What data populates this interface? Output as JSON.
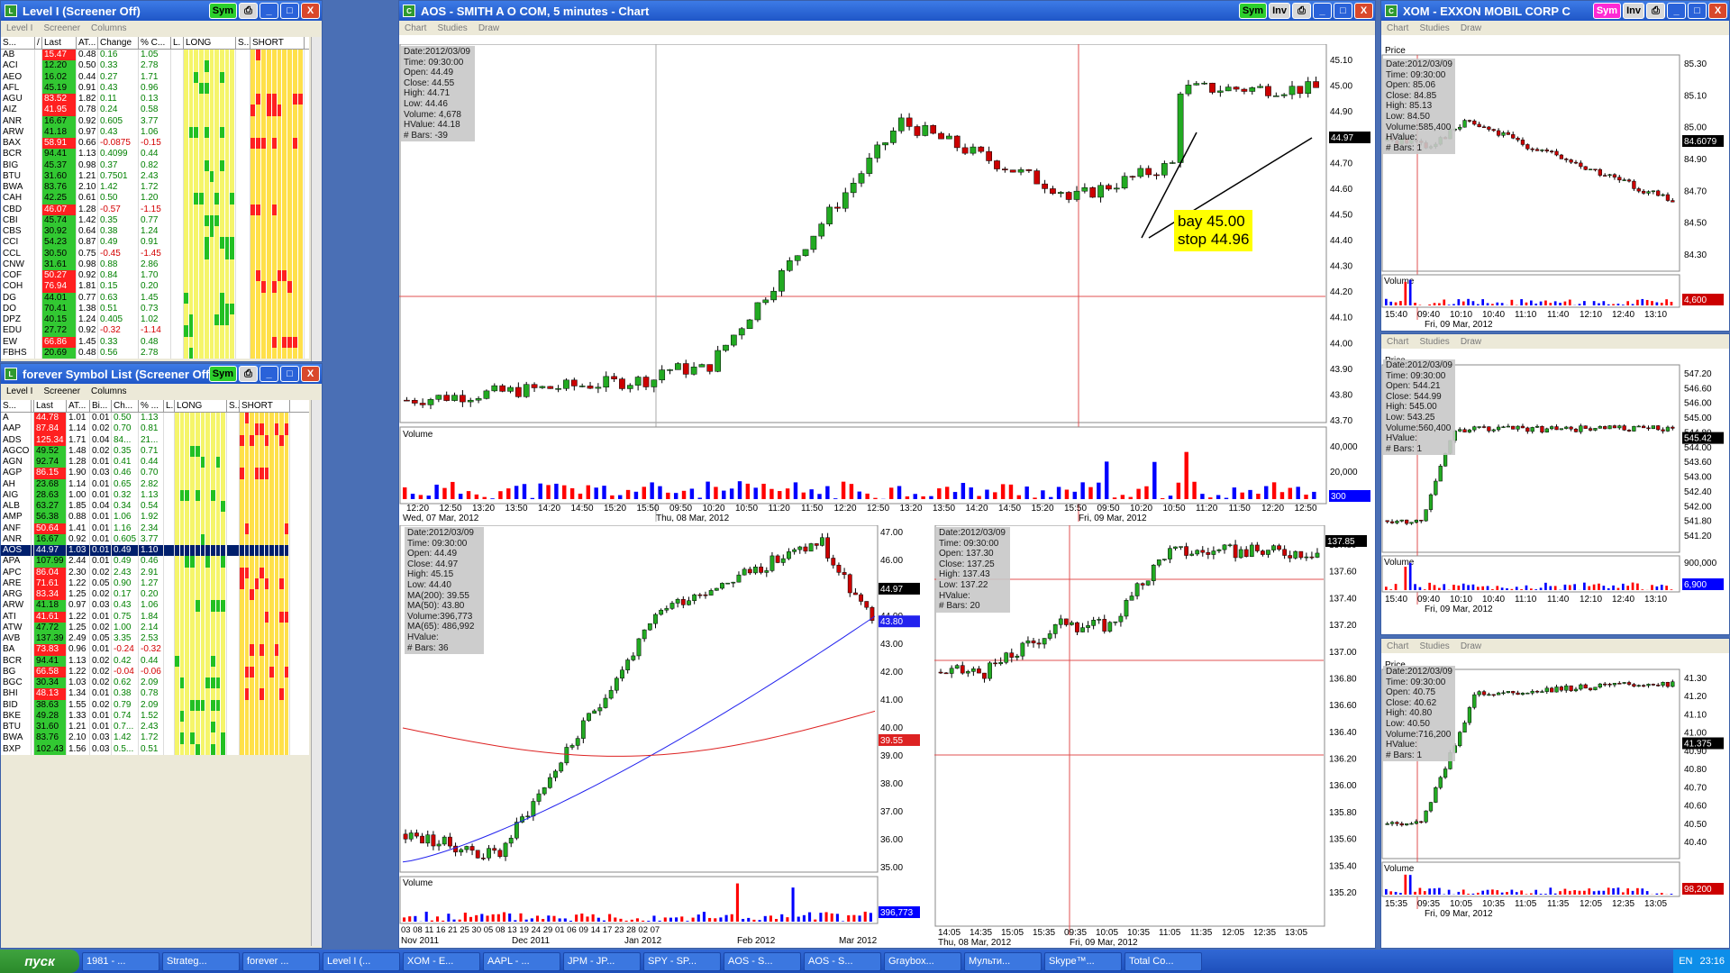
{
  "level1": {
    "title": "Level I (Screener Off)",
    "menu": [
      "Level I",
      "Screener",
      "Columns"
    ],
    "cols": [
      "S...",
      "/",
      "Last",
      "AT...",
      "Change",
      "% C...",
      "L.",
      "LONG",
      "S...",
      "SHORT"
    ],
    "rows": [
      [
        "AB",
        "15.47",
        "0.48",
        "0.16",
        "1.05",
        "r"
      ],
      [
        "ACI",
        "12.20",
        "0.50",
        "0.33",
        "2.78",
        "g"
      ],
      [
        "AEO",
        "16.02",
        "0.44",
        "0.27",
        "1.71",
        "g"
      ],
      [
        "AFL",
        "45.19",
        "0.91",
        "0.43",
        "0.96",
        "g"
      ],
      [
        "AGU",
        "83.52",
        "1.82",
        "0.11",
        "0.13",
        "r"
      ],
      [
        "AIZ",
        "41.95",
        "0.78",
        "0.24",
        "0.58",
        "r"
      ],
      [
        "ANR",
        "16.67",
        "0.92",
        "0.605",
        "3.77",
        "g"
      ],
      [
        "ARW",
        "41.18",
        "0.97",
        "0.43",
        "1.06",
        "g"
      ],
      [
        "BAX",
        "58.91",
        "0.66",
        "-0.0875",
        "-0.15",
        "r"
      ],
      [
        "BCR",
        "94.41",
        "1.13",
        "0.4099",
        "0.44",
        "g"
      ],
      [
        "BIG",
        "45.37",
        "0.98",
        "0.37",
        "0.82",
        "g"
      ],
      [
        "BTU",
        "31.60",
        "1.21",
        "0.7501",
        "2.43",
        "g"
      ],
      [
        "BWA",
        "83.76",
        "2.10",
        "1.42",
        "1.72",
        "g"
      ],
      [
        "CAH",
        "42.25",
        "0.61",
        "0.50",
        "1.20",
        "g"
      ],
      [
        "CBD",
        "46.07",
        "1.28",
        "-0.57",
        "-1.15",
        "r"
      ],
      [
        "CBI",
        "45.74",
        "1.42",
        "0.35",
        "0.77",
        "g"
      ],
      [
        "CBS",
        "30.92",
        "0.64",
        "0.38",
        "1.24",
        "g"
      ],
      [
        "CCI",
        "54.23",
        "0.87",
        "0.49",
        "0.91",
        "g"
      ],
      [
        "CCL",
        "30.50",
        "0.75",
        "-0.45",
        "-1.45",
        "g"
      ],
      [
        "CNW",
        "31.61",
        "0.98",
        "0.88",
        "2.86",
        "g"
      ],
      [
        "COF",
        "50.27",
        "0.92",
        "0.84",
        "1.70",
        "r"
      ],
      [
        "COH",
        "76.94",
        "1.81",
        "0.15",
        "0.20",
        "r"
      ],
      [
        "DG",
        "44.01",
        "0.77",
        "0.63",
        "1.45",
        "g"
      ],
      [
        "DO",
        "70.41",
        "1.38",
        "0.51",
        "0.73",
        "g"
      ],
      [
        "DPZ",
        "40.15",
        "1.24",
        "0.405",
        "1.02",
        "g"
      ],
      [
        "EDU",
        "27.72",
        "0.92",
        "-0.32",
        "-1.14",
        "g"
      ],
      [
        "EW",
        "66.86",
        "1.45",
        "0.33",
        "0.48",
        "r"
      ],
      [
        "FBHS",
        "20.69",
        "0.48",
        "0.56",
        "2.78",
        "g"
      ]
    ]
  },
  "forever": {
    "title": "forever Symbol List (Screener Off)",
    "menu": [
      "Level I",
      "Screener",
      "Columns"
    ],
    "cols": [
      "S...",
      "/",
      "Last",
      "AT...",
      "Bi...",
      "Ch...",
      "% ...",
      "L.",
      "LONG",
      "S...",
      "SHORT"
    ],
    "rows": [
      [
        "A",
        "44.78",
        "1.01",
        "0.01",
        "0.50",
        "1.13",
        "r"
      ],
      [
        "AAP",
        "87.84",
        "1.14",
        "0.02",
        "0.70",
        "0.81",
        "r"
      ],
      [
        "ADS",
        "125.34",
        "1.71",
        "0.04",
        "84...",
        "21...",
        "r"
      ],
      [
        "AGCO",
        "49.52",
        "1.48",
        "0.02",
        "0.35",
        "0.71",
        "g"
      ],
      [
        "AGN",
        "92.74",
        "1.28",
        "0.01",
        "0.41",
        "0.44",
        "g"
      ],
      [
        "AGP",
        "86.15",
        "1.90",
        "0.03",
        "0.46",
        "0.70",
        "r"
      ],
      [
        "AH",
        "23.68",
        "1.14",
        "0.01",
        "0.65",
        "2.82",
        "g"
      ],
      [
        "AIG",
        "28.63",
        "1.00",
        "0.01",
        "0.32",
        "1.13",
        "g"
      ],
      [
        "ALB",
        "63.27",
        "1.85",
        "0.04",
        "0.34",
        "0.54",
        "g"
      ],
      [
        "AMP",
        "56.38",
        "0.88",
        "0.01",
        "1.06",
        "1.92",
        "g"
      ],
      [
        "ANF",
        "50.64",
        "1.41",
        "0.01",
        "1.16",
        "2.34",
        "r"
      ],
      [
        "ANR",
        "16.67",
        "0.92",
        "0.01",
        "0.605",
        "3.77",
        "g"
      ],
      [
        "AOS",
        "44.97",
        "1.03",
        "0.01",
        "0.49",
        "1.10",
        "sel"
      ],
      [
        "APA",
        "107.99",
        "2.44",
        "0.01",
        "0.49",
        "0.46",
        "g"
      ],
      [
        "APC",
        "86.04",
        "2.30",
        "0.02",
        "2.43",
        "2.91",
        "r"
      ],
      [
        "ARE",
        "71.61",
        "1.22",
        "0.05",
        "0.90",
        "1.27",
        "r"
      ],
      [
        "ARG",
        "83.34",
        "1.25",
        "0.02",
        "0.17",
        "0.20",
        "r"
      ],
      [
        "ARW",
        "41.18",
        "0.97",
        "0.03",
        "0.43",
        "1.06",
        "g"
      ],
      [
        "ATI",
        "41.61",
        "1.22",
        "0.01",
        "0.75",
        "1.84",
        "r"
      ],
      [
        "ATW",
        "47.72",
        "1.25",
        "0.02",
        "1.00",
        "2.14",
        "g"
      ],
      [
        "AVB",
        "137.39",
        "2.49",
        "0.05",
        "3.35",
        "2.53",
        "g"
      ],
      [
        "BA",
        "73.83",
        "0.96",
        "0.01",
        "-0.24",
        "-0.32",
        "r"
      ],
      [
        "BCR",
        "94.41",
        "1.13",
        "0.02",
        "0.42",
        "0.44",
        "g"
      ],
      [
        "BG",
        "66.58",
        "1.22",
        "0.02",
        "-0.04",
        "-0.06",
        "r"
      ],
      [
        "BGC",
        "30.34",
        "1.03",
        "0.02",
        "0.62",
        "2.09",
        "g"
      ],
      [
        "BHI",
        "48.13",
        "1.34",
        "0.01",
        "0.38",
        "0.78",
        "r"
      ],
      [
        "BID",
        "38.63",
        "1.55",
        "0.02",
        "0.79",
        "2.09",
        "g"
      ],
      [
        "BKE",
        "49.28",
        "1.33",
        "0.01",
        "0.74",
        "1.52",
        "g"
      ],
      [
        "BTU",
        "31.60",
        "1.21",
        "0.01",
        "0.7...",
        "2.43",
        "g"
      ],
      [
        "BWA",
        "83.76",
        "2.10",
        "0.03",
        "1.42",
        "1.72",
        "g"
      ],
      [
        "BXP",
        "102.43",
        "1.56",
        "0.03",
        "0.5...",
        "0.51",
        "g"
      ]
    ]
  },
  "aos": {
    "title": "AOS - SMITH A O COM, 5 minutes - Chart",
    "menu": [
      "Chart",
      "Studies",
      "Draw"
    ],
    "info": [
      "Date:2012/03/09",
      "Time:    09:30:00",
      "Open:       44.49",
      "Close:      44.55",
      "High:        44.71",
      "Low:         44.46",
      "Volume:    4,678",
      "HValue:    44.18",
      "# Bars:        -39"
    ],
    "yticks": [
      "45.10",
      "45.00",
      "44.90",
      "44.80",
      "44.70",
      "44.60",
      "44.50",
      "44.40",
      "44.30",
      "44.20",
      "44.10",
      "44.00",
      "43.90",
      "43.80",
      "43.70"
    ],
    "last": "44.97",
    "vol_label": "Volume",
    "vol_ticks": [
      "40,000",
      "20,000"
    ],
    "vol_last": "300",
    "xticks": [
      "12:20",
      "12:50",
      "13:20",
      "13:50",
      "14:20",
      "14:50",
      "15:20",
      "15:50",
      "09:50",
      "10:20",
      "10:50",
      "11:20",
      "11:50",
      "12:20",
      "12:50",
      "13:20",
      "13:50",
      "14:20",
      "14:50",
      "15:20",
      "15:50",
      "09:50",
      "10:20",
      "10:50",
      "11:20",
      "11:50",
      "12:20",
      "12:50"
    ],
    "dates": [
      "Wed, 07 Mar, 2012",
      "Thu, 08 Mar, 2012",
      "Fri, 09 Mar, 2012"
    ],
    "note1": "bay 45.00",
    "note2": "stop 44.96"
  },
  "daily": {
    "info": [
      "Date:2012/03/09",
      "Time:    09:30:00",
      "Open:       44.49",
      "Close:      44.97",
      "High:        45.15",
      "Low:         44.40",
      "MA(200):   39.55",
      "MA(50):     43.80",
      "Volume:396,773",
      "MA(65):  486,992",
      "HValue:",
      "# Bars:          36"
    ],
    "yticks": [
      "47.00",
      "46.00",
      "45.00",
      "44.00",
      "43.00",
      "42.00",
      "41.00",
      "40.00",
      "39.00",
      "38.00",
      "37.00",
      "36.00",
      "35.00"
    ],
    "last": "44.97",
    "ma50": "43.80",
    "ma200": "39.55",
    "vol_label": "Volume",
    "vol_last": "396,773",
    "xticks": "03 08 11 16 21 25 30 05 08 13 19 24 29 01 06 09 14 17 23 28 02 07",
    "dates": [
      "Nov 2011",
      "Dec 2011",
      "Jan 2012",
      "Feb 2012",
      "Mar 2012"
    ]
  },
  "mid": {
    "info": [
      "Date:2012/03/09",
      "Time:    09:30:00",
      "Open:     137.30",
      "Close:    137.25",
      "High:      137.43",
      "Low:       137.22",
      "HValue:",
      "# Bars:          20"
    ],
    "yticks": [
      "137.80",
      "137.60",
      "137.40",
      "137.20",
      "137.00",
      "136.80",
      "136.60",
      "136.40",
      "136.20",
      "136.00",
      "135.80",
      "135.60",
      "135.40",
      "135.20"
    ],
    "last": "137.85",
    "xticks": [
      "14:05",
      "14:35",
      "15:05",
      "15:35",
      "09:35",
      "10:05",
      "10:35",
      "11:05",
      "11:35",
      "12:05",
      "12:35",
      "13:05"
    ],
    "dates": [
      "Thu, 08 Mar, 2012",
      "Fri, 09 Mar, 2012"
    ]
  },
  "xom": {
    "title": "XOM - EXXON MOBIL CORP C",
    "menu": [
      "Chart",
      "Studies",
      "Draw"
    ],
    "price_label": "Price",
    "info": [
      "Date:2012/03/09",
      "Time:    09:30:00",
      "Open:       85.06",
      "Close:      84.85",
      "High:        85.13",
      "Low:         84.50",
      "Volume:585,400",
      "HValue:",
      "# Bars:          1"
    ],
    "yticks": [
      "85.30",
      "85.10",
      "85.00",
      "84.90",
      "84.70",
      "84.50",
      "84.30"
    ],
    "last": "84.6079",
    "vol_label": "Volume",
    "vol_last": "4,600",
    "xticks": [
      "15:40",
      "09:40",
      "10:10",
      "10:40",
      "11:10",
      "11:40",
      "12:10",
      "12:40",
      "13:10"
    ],
    "date": "Fri, 09 Mar, 2012"
  },
  "r2": {
    "menu": [
      "Chart",
      "Studies",
      "Draw"
    ],
    "price_label": "Price",
    "info": [
      "Date:2012/03/09",
      "Time:    09:30:00",
      "Open:     544.21",
      "Close:    544.99",
      "High:      545.00",
      "Low:       543.25",
      "Volume:560,400",
      "HValue:",
      "# Bars:          1"
    ],
    "yticks": [
      "547.20",
      "546.60",
      "546.00",
      "545.00",
      "544.80",
      "544.00",
      "543.60",
      "543.00",
      "542.40",
      "542.00",
      "541.80",
      "541.20"
    ],
    "last": "545.42",
    "vol_label": "Volume",
    "vol_ticks": [
      "900,000"
    ],
    "vol_last": "6,900",
    "xticks": [
      "15:40",
      "09:40",
      "10:10",
      "10:40",
      "11:10",
      "11:40",
      "12:10",
      "12:40",
      "13:10"
    ],
    "date": "Fri, 09 Mar, 2012"
  },
  "r3": {
    "menu": [
      "Chart",
      "Studies",
      "Draw"
    ],
    "price_label": "Price",
    "info": [
      "Date:2012/03/09",
      "Time:    09:30:00",
      "Open:       40.75",
      "Close:      40.62",
      "High:        40.80",
      "Low:         40.50",
      "Volume:716,200",
      "HValue:",
      "# Bars:          1"
    ],
    "yticks": [
      "41.30",
      "41.20",
      "41.10",
      "41.00",
      "40.90",
      "40.80",
      "40.70",
      "40.60",
      "40.50",
      "40.40"
    ],
    "last": "41.375",
    "vol_label": "Volume",
    "vol_last": "98,200",
    "xticks": [
      "15:35",
      "09:35",
      "10:05",
      "10:35",
      "11:05",
      "11:35",
      "12:05",
      "12:35",
      "13:05"
    ],
    "date": "Fri, 09 Mar, 2012"
  },
  "buttons": {
    "sym": "Sym",
    "inv": "Inv",
    "min": "_",
    "max": "□",
    "close": "X",
    "print": "⎙"
  },
  "taskbar": {
    "start": "пуск",
    "items": [
      "1981 - ...",
      "Strateg...",
      "forever ...",
      "Level I (...",
      "XOM - E...",
      "AAPL - ...",
      "JPM - JP...",
      "SPY - SP...",
      "AOS - S...",
      "AOS - S...",
      "Graybox...",
      "Мульти...",
      "Skype™...",
      "Total Co..."
    ],
    "lang": "EN",
    "clock": "23:16"
  },
  "colors": {
    "title_blue": "#1f56c7",
    "sym_green": "#2ccf2c",
    "sym_magenta": "#ff29d4",
    "up": "#22aa22",
    "down": "#cc0000",
    "vol_red": "#ff0000",
    "vol_blue": "#0000ff"
  }
}
